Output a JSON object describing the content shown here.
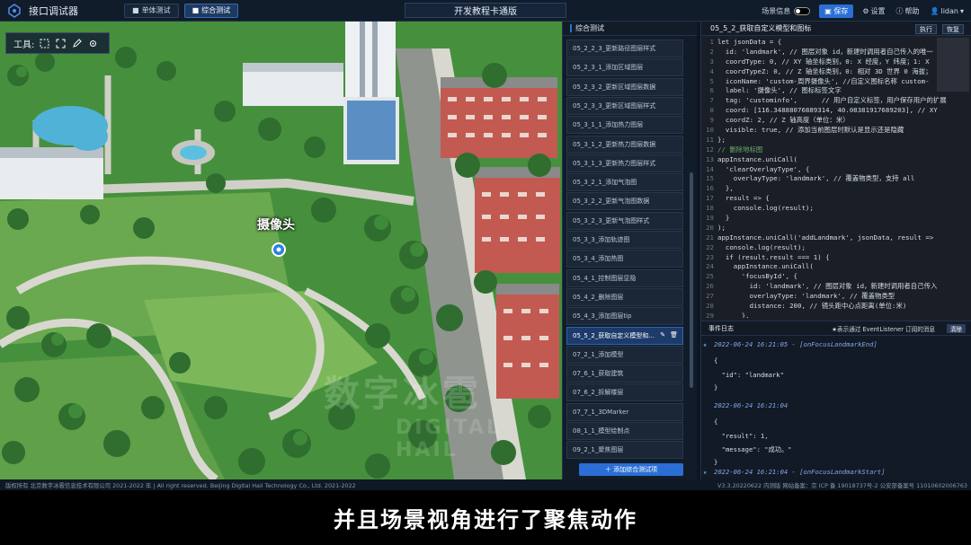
{
  "app": {
    "title": "接口调试器",
    "center_title": "开发教程卡通版"
  },
  "topbar": {
    "tab_single": "单体测试",
    "tab_multi": "综合测试",
    "scene_info": "场景信息",
    "save": "保存",
    "settings": "设置",
    "help": "帮助",
    "user": "lidan"
  },
  "scene": {
    "toolbar_label": "工具:",
    "marker_label": "摄像头",
    "watermark_cn": "数字冰雹",
    "watermark_en": "DIGITAL HAIL"
  },
  "list": {
    "title": "综合测试",
    "items": [
      "05_2_2_3_更新路径图层样式",
      "05_2_3_1_添加区域图层",
      "05_2_3_2_更新区域图层数据",
      "05_2_3_3_更新区域图层样式",
      "05_3_1_1_添加热力图层",
      "05_3_1_2_更新热力图层数据",
      "05_3_1_3_更新热力图层样式",
      "05_3_2_1_添加气泡图",
      "05_3_2_2_更新气泡图数据",
      "05_3_2_3_更新气泡图样式",
      "05_3_3_添加轨迹图",
      "05_3_4_添加热图",
      "05_4_1_控制图层显隐",
      "05_4_2_删除图层",
      "05_4_3_添加图层tip",
      "05_5_2_获取自定义模型和...",
      "07_2_1_添加模型",
      "07_6_1_获取建筑",
      "07_6_2_拆解楼层",
      "07_7_1_3DMarker",
      "08_1_1_模型绘制点",
      "09_2_1_聚焦图层"
    ],
    "active_index": 15,
    "add_button": "＋ 添加综合测试项"
  },
  "code": {
    "title": "05_5_2_获取自定义模型和图标",
    "run": "执行",
    "restore": "恢复",
    "lines": [
      "let jsonData = {",
      "  id: 'landmark', // 图层对象 id，新建时调用者自己传入的唯一",
      "  coordType: 0, // XY 轴坐标类别，0: X 经度，Y 纬度；1: X",
      "  coordTypeZ: 0, // Z 轴坐标类别，0: 相对 3D 世界 0 海拔；",
      "  iconName: 'custom-周界摄像头', //自定义图标名称 custom-",
      "  label: '摄像头', // 图标标签文字",
      "  tag: 'custominfo',      // 用户自定义标签，用户保存用户的扩展",
      "  coord: [116.34888076889314, 40.08381917689203], // XY",
      "  coordZ: 2, // Z 轴高度（单位：米）",
      "  visible: true, // 添加当前图层时默认是显示还是隐藏",
      "};",
      "// 删除地标图",
      "appInstance.uniCall(",
      "  'clearOverlayType', {",
      "    overlayType: 'landmark', // 覆盖物类型，支持 all",
      "  },",
      "  result => {",
      "    console.log(result);",
      "  }",
      ");",
      "appInstance.uniCall('addLandmark', jsonData, result =>",
      "  console.log(result);",
      "  if (result.result === 1) {",
      "    appInstance.uniCall(",
      "      'focusById', {",
      "        id: 'landmark', // 图层对象 id，新建时调用者自己传入",
      "        overlayType: 'landmark', // 覆盖物类型",
      "        distance: 200, // 镜头距中心点距离(单位:米)",
      "      },"
    ]
  },
  "events": {
    "title": "事件日志",
    "note": "★表示通过 EventListener 订阅的消息",
    "clear": "清除",
    "lines": [
      {
        "t": "2022-06-24 16:21:05 - [onFocusLandmarkEnd]",
        "star": true
      },
      {
        "t": "{"
      },
      {
        "t": "  \"id\": \"landmark\""
      },
      {
        "t": "}"
      },
      {
        "t": "2022-06-24 16:21:04",
        "star": false
      },
      {
        "t": "{"
      },
      {
        "t": "  \"result\": 1,"
      },
      {
        "t": "  \"message\": \"成功。\""
      },
      {
        "t": "}"
      },
      {
        "t": "2022-06-24 16:21:04 - [onFocusLandmarkStart]",
        "star": true
      },
      {
        "t": "{"
      }
    ]
  },
  "footer": {
    "left": "版权所有 北京数字冰雹信息技术有限公司 2021-2022 年 | All right reserved. Beijing Digital Hail Technology Co., Ltd. 2021-2022",
    "right": "V3.3.20220622 内测版  网站备案：京 ICP 备 19018737号-2 公安部备案号 11010602006763"
  },
  "subtitle": "并且场景视角进行了聚焦动作",
  "colors": {
    "accent": "#2b6fd6",
    "grass": "#4a9a3f",
    "path": "#c9c9c2",
    "building": "#c25a52"
  }
}
